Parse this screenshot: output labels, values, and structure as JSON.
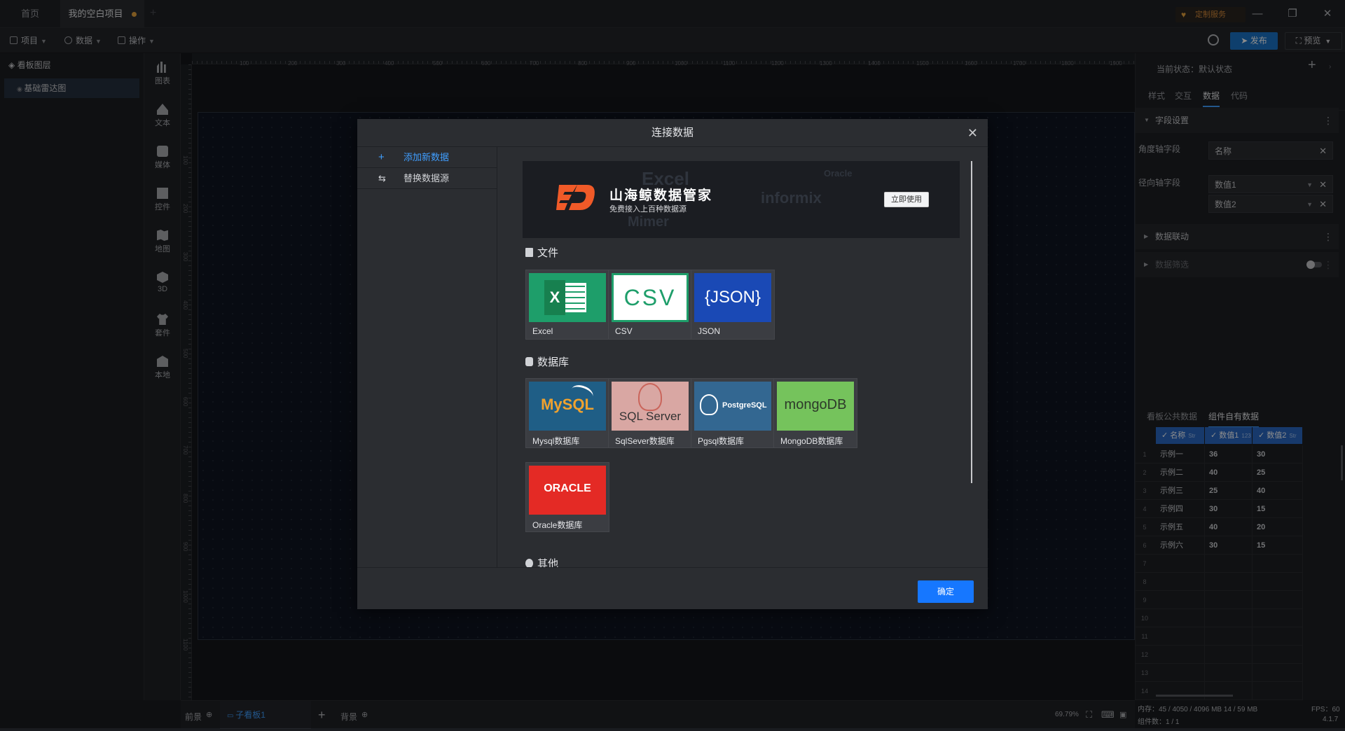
{
  "titlebar": {
    "tabs": [
      {
        "label": "首页"
      },
      {
        "label": "我的空白项目"
      }
    ],
    "custom_service": "定制服务"
  },
  "toolbar": {
    "menus": [
      {
        "label": "项目"
      },
      {
        "label": "数据"
      },
      {
        "label": "操作"
      }
    ],
    "publish_label": "发布",
    "preview_label": "预览"
  },
  "layers": {
    "header": "看板图层",
    "items": [
      {
        "label": "基础雷达图"
      }
    ]
  },
  "components": [
    {
      "label": "图表",
      "icon": "bar-chart-icon"
    },
    {
      "label": "文本",
      "icon": "text-icon"
    },
    {
      "label": "媒体",
      "icon": "media-icon"
    },
    {
      "label": "控件",
      "icon": "widget-icon"
    },
    {
      "label": "地图",
      "icon": "map-icon"
    },
    {
      "label": "3D",
      "icon": "cube-icon"
    },
    {
      "label": "套件",
      "icon": "shirt-icon"
    },
    {
      "label": "本地",
      "icon": "local-icon"
    }
  ],
  "ruler": {
    "top_marks": [
      "100",
      "200",
      "300",
      "400",
      "500",
      "600",
      "700",
      "800",
      "900",
      "1000",
      "1100",
      "1200",
      "1300",
      "1400",
      "1500",
      "1600",
      "1700",
      "1800",
      "1900"
    ],
    "left_marks": [
      "100",
      "200",
      "300",
      "400",
      "500",
      "600",
      "700",
      "800",
      "900",
      "1000",
      "1100"
    ]
  },
  "bottombar": {
    "foreground_label": "前景",
    "subboard_label": "子看板1",
    "background_label": "背景",
    "zoom": "69.79%"
  },
  "rightpanel": {
    "state_label": "当前状态：默认状态",
    "tabs": [
      {
        "label": "样式"
      },
      {
        "label": "交互"
      },
      {
        "label": "数据"
      },
      {
        "label": "代码"
      }
    ],
    "field_section": "字段设置",
    "angle_label": "角度轴字段",
    "angle_value": "名称",
    "radial_label": "径向轴字段",
    "radial_values": [
      "数值1",
      "数值2"
    ],
    "linkage_section": "数据联动",
    "filter_section": "数据筛选",
    "data_tabs": [
      {
        "label": "看板公共数据"
      },
      {
        "label": "组件自有数据"
      }
    ]
  },
  "datatable": {
    "columns": [
      {
        "label": "名称",
        "type": "Str"
      },
      {
        "label": "数值1",
        "type": "123"
      },
      {
        "label": "数值2",
        "type": "Str"
      }
    ],
    "rows": [
      {
        "n": "1",
        "c": [
          "示例一",
          "36",
          "30"
        ]
      },
      {
        "n": "2",
        "c": [
          "示例二",
          "40",
          "25"
        ]
      },
      {
        "n": "3",
        "c": [
          "示例三",
          "25",
          "40"
        ]
      },
      {
        "n": "4",
        "c": [
          "示例四",
          "30",
          "15"
        ]
      },
      {
        "n": "5",
        "c": [
          "示例五",
          "40",
          "20"
        ]
      },
      {
        "n": "6",
        "c": [
          "示例六",
          "30",
          "15"
        ]
      },
      {
        "n": "7",
        "c": [
          "",
          "",
          ""
        ]
      },
      {
        "n": "8",
        "c": [
          "",
          "",
          ""
        ]
      },
      {
        "n": "9",
        "c": [
          "",
          "",
          ""
        ]
      },
      {
        "n": "10",
        "c": [
          "",
          "",
          ""
        ]
      },
      {
        "n": "11",
        "c": [
          "",
          "",
          ""
        ]
      },
      {
        "n": "12",
        "c": [
          "",
          "",
          ""
        ]
      },
      {
        "n": "13",
        "c": [
          "",
          "",
          ""
        ]
      },
      {
        "n": "14",
        "c": [
          "",
          "",
          ""
        ]
      }
    ]
  },
  "status": {
    "memory": "内存：45 / 4050 / 4096 MB  14 / 59 MB",
    "fps": "FPS：60",
    "components": "组件数：1 / 1",
    "version": "4.1.7"
  },
  "modal": {
    "title": "连接数据",
    "side": [
      {
        "label": "添加新数据"
      },
      {
        "label": "替换数据源"
      }
    ],
    "banner": {
      "title": "山海鲸数据管家",
      "subtitle": "免费接入上百种数据源",
      "button": "立即使用",
      "bg_words": [
        "Excel",
        "informix",
        "Mimer",
        "Oracle"
      ]
    },
    "file_group": "文件",
    "files": [
      {
        "name": "Excel",
        "thumb_text": "X"
      },
      {
        "name": "CSV",
        "thumb_text": "CSV"
      },
      {
        "name": "JSON",
        "thumb_text": "{JSON}"
      }
    ],
    "db_group": "数据库",
    "databases": [
      {
        "name": "Mysql数据库",
        "thumb_text": "MySQL"
      },
      {
        "name": "SqlSever数据库",
        "thumb_text": "SQL Server"
      },
      {
        "name": "Pgsql数据库",
        "thumb_text": "PostgreSQL"
      },
      {
        "name": "MongoDB数据库",
        "thumb_text": "mongoDB"
      },
      {
        "name": "Oracle数据库",
        "thumb_text": "ORACLE"
      }
    ],
    "other_group": "其他",
    "ok_label": "确定"
  },
  "colors": {
    "accent": "#1677ff",
    "excel": "#1e9e6a",
    "csv": "#1e9e6a",
    "json": "#1a49b5",
    "mysql": "#1f5e86",
    "mssql": "#c9726d",
    "pgsql": "#336791",
    "mongo": "#75c35c",
    "oracle": "#e42a25"
  }
}
